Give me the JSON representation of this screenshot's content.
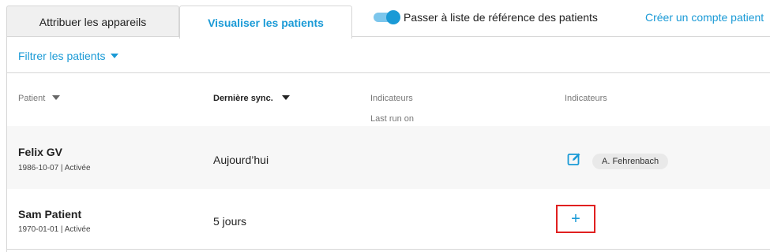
{
  "tabs": [
    {
      "label": "Attribuer les appareils",
      "active": false
    },
    {
      "label": "Visualiser les patients",
      "active": true
    }
  ],
  "toggle": {
    "label": "Passer à liste de référence des patients",
    "on": true
  },
  "create_account_link": "Créer un compte patient",
  "filter": {
    "label": "Filtrer les patients",
    "icon": "caret-down-icon"
  },
  "table": {
    "columns": [
      {
        "label": "Patient",
        "sort_icon": "caret-down-icon"
      },
      {
        "label": "Dernière sync.",
        "sort_icon": "caret-down-icon",
        "sorted": true
      },
      {
        "label": "Indicateurs",
        "sublabel": "Last run on"
      },
      {
        "label": "Indicateurs"
      }
    ],
    "rows": [
      {
        "name": "Felix GV",
        "meta": "1986-10-07 | Activée",
        "last_sync": "Aujourd’hui",
        "indicator_icon": "edit-icon",
        "assignee": "A. Fehrenbach"
      },
      {
        "name": "Sam Patient",
        "meta": "1970-01-01 | Activée",
        "last_sync": "5 jours",
        "indicator_action": "+"
      }
    ]
  },
  "colors": {
    "accent": "#1a9ad6",
    "highlight": "#e02020",
    "row_alt": "#f7f7f7",
    "border": "#d6d6d6"
  }
}
